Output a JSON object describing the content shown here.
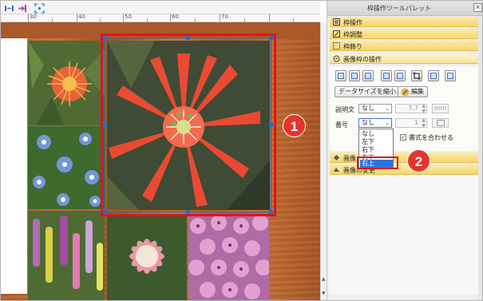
{
  "palette": {
    "title": "枠操作ツールパレット",
    "close_label": "×",
    "sections": [
      {
        "label": "枠操作",
        "icon": "frame-icon"
      },
      {
        "label": "枠調整",
        "icon": "frame-adjust-icon"
      },
      {
        "label": "枠飾り",
        "icon": "frame-decor-icon"
      },
      {
        "label": "画像枠の操作",
        "icon": "image-frame-icon"
      }
    ],
    "lower_sections": [
      {
        "label": "画像",
        "icon": "image-icon"
      },
      {
        "label": "画像の変更",
        "icon": "image-change-icon"
      }
    ],
    "data_resize_label": "データサイズを縮小...",
    "edit_label": "編集",
    "caption_label": "説明文",
    "caption_value": "なし",
    "caption_size": "7.7",
    "caption_unit": "mm",
    "number_label": "番号",
    "number_value": "なし",
    "number_count": "1",
    "match_format_label": "書式を合わせる",
    "dropdown_options": [
      "なし",
      "左下",
      "右下",
      "右上"
    ],
    "dropdown_selected": "右上"
  },
  "ruler": {
    "ticks": [
      "0",
      "30",
      "40",
      "50",
      "60",
      "70"
    ]
  },
  "annotations": {
    "badge1": "1",
    "badge2": "2"
  },
  "colors": {
    "selection_red": "#e0141d",
    "section_header": "#f6d66e",
    "dropdown_selected": "#2d73d8",
    "wood": "#b45f29"
  }
}
